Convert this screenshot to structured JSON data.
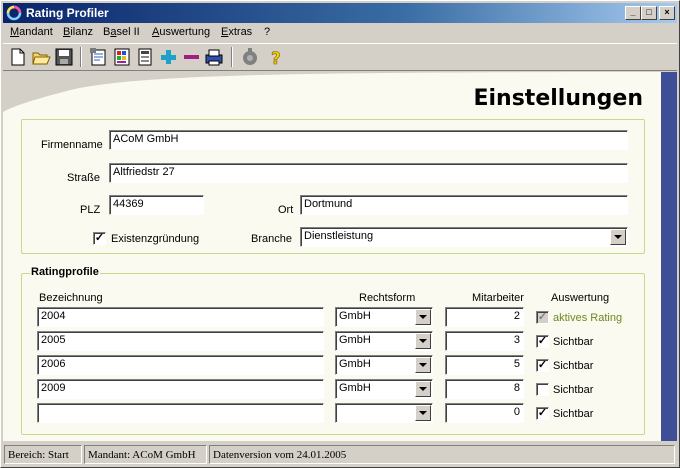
{
  "window": {
    "title": "Rating Profiler"
  },
  "menu": [
    "Mandant",
    "Bilanz",
    "Basel II",
    "Auswertung",
    "Extras",
    "?"
  ],
  "menu_underline": [
    "M",
    "B",
    "a",
    "A",
    "E",
    ""
  ],
  "toolbar_icons": [
    "new-document-icon",
    "open-folder-icon",
    "save-disk-icon",
    "properties-icon",
    "color-palette-icon",
    "document-list-icon",
    "plus-icon",
    "minus-icon",
    "print-icon",
    "gear-icon",
    "help-icon"
  ],
  "page": {
    "title": "Einstellungen"
  },
  "company": {
    "firmenname_label": "Firmenname",
    "firmenname": "ACoM GmbH",
    "strasse_label": "Straße",
    "strasse": "Altfriedstr 27",
    "plz_label": "PLZ",
    "plz": "44369",
    "ort_label": "Ort",
    "ort": "Dortmund",
    "existenz_label": "Existenzgründung",
    "existenz_checked": true,
    "branche_label": "Branche",
    "branche": "Dienstleistung"
  },
  "profiles": {
    "legend": "Ratingprofile",
    "headers": {
      "bezeichnung": "Bezeichnung",
      "rechtsform": "Rechtsform",
      "mitarbeiter": "Mitarbeiter",
      "auswertung": "Auswertung"
    },
    "rows": [
      {
        "bezeichnung": "2004",
        "rechtsform": "GmbH",
        "mitarbeiter": "2",
        "checked": true,
        "disabled": true,
        "auswertung": "aktives Rating"
      },
      {
        "bezeichnung": "2005",
        "rechtsform": "GmbH",
        "mitarbeiter": "3",
        "checked": true,
        "disabled": false,
        "auswertung": "Sichtbar"
      },
      {
        "bezeichnung": "2006",
        "rechtsform": "GmbH",
        "mitarbeiter": "5",
        "checked": true,
        "disabled": false,
        "auswertung": "Sichtbar"
      },
      {
        "bezeichnung": "2009",
        "rechtsform": "GmbH",
        "mitarbeiter": "8",
        "checked": false,
        "disabled": false,
        "auswertung": "Sichtbar"
      },
      {
        "bezeichnung": "",
        "rechtsform": "",
        "mitarbeiter": "0",
        "checked": true,
        "disabled": false,
        "auswertung": "Sichtbar"
      }
    ]
  },
  "status": {
    "bereich": "Bereich: Start",
    "mandant": "Mandant: ACoM GmbH",
    "version": "Datenversion vom 24.01.2005"
  },
  "colors": {
    "accent_bar": "#3f4f97",
    "active_rating_text": "#6b8a1f",
    "group_border": "#c9d98a"
  }
}
